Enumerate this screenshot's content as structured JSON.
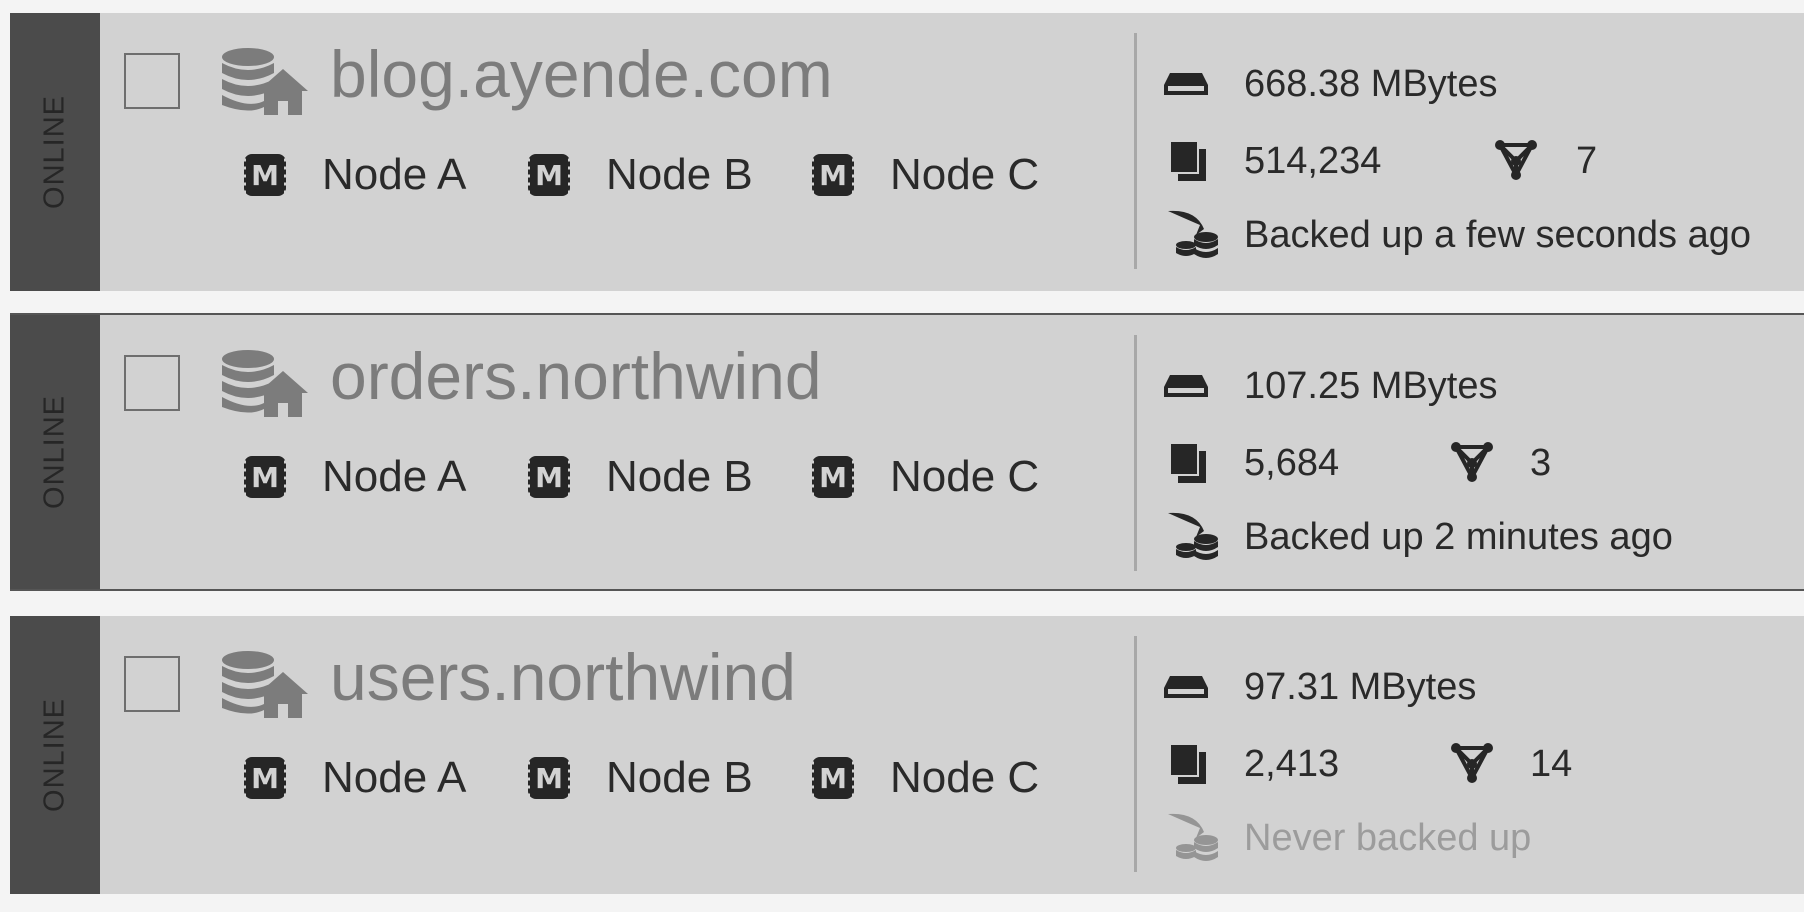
{
  "databases": [
    {
      "status": "ONLINE",
      "name": "blog.ayende.com",
      "nodes": [
        "Node A",
        "Node B",
        "Node C"
      ],
      "size": "668.38 MBytes",
      "documents": "514,234",
      "indexes": "7",
      "backup": "Backed up a few seconds ago",
      "backup_muted": false
    },
    {
      "status": "ONLINE",
      "name": "orders.northwind",
      "nodes": [
        "Node A",
        "Node B",
        "Node C"
      ],
      "size": "107.25 MBytes",
      "documents": "5,684",
      "indexes": "3",
      "backup": "Backed up 2 minutes ago",
      "backup_muted": false
    },
    {
      "status": "ONLINE",
      "name": "users.northwind",
      "nodes": [
        "Node A",
        "Node B",
        "Node C"
      ],
      "size": "97.31 MBytes",
      "documents": "2,413",
      "indexes": "14",
      "backup": "Never backed up",
      "backup_muted": true
    }
  ],
  "icons": {
    "database": "database-home-icon",
    "node": "node-member-icon",
    "size": "storage-icon",
    "documents": "documents-icon",
    "indexes": "index-icon",
    "backup": "backup-icon"
  },
  "colors": {
    "status_strip": "#4b4b4b",
    "row_background": "#d2d2d2",
    "db_name": "#7c7c7c",
    "muted_text": "#9c9c9c"
  }
}
